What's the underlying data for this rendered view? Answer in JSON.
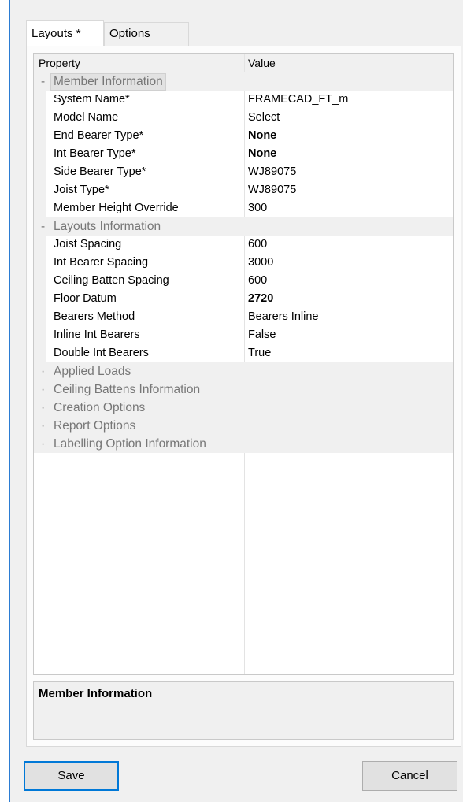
{
  "tabs": [
    {
      "label": "Layouts *",
      "active": true
    },
    {
      "label": "Options",
      "active": false
    }
  ],
  "grid": {
    "header": {
      "property": "Property",
      "value": "Value"
    },
    "rows": [
      {
        "kind": "cat",
        "toggle": "-",
        "label": "Member Information",
        "selected": true
      },
      {
        "kind": "prop",
        "label": "System Name*",
        "value": "FRAMECAD_FT_m",
        "bold": false
      },
      {
        "kind": "prop",
        "label": "Model Name",
        "value": "Select",
        "bold": false
      },
      {
        "kind": "prop",
        "label": "End Bearer Type*",
        "value": "None",
        "bold": true
      },
      {
        "kind": "prop",
        "label": "Int Bearer Type*",
        "value": "None",
        "bold": true
      },
      {
        "kind": "prop",
        "label": "Side Bearer Type*",
        "value": "WJ89075",
        "bold": false
      },
      {
        "kind": "prop",
        "label": "Joist Type*",
        "value": "WJ89075",
        "bold": false
      },
      {
        "kind": "prop",
        "label": "Member Height Override",
        "value": "300",
        "bold": false
      },
      {
        "kind": "cat",
        "toggle": "-",
        "label": "Layouts Information",
        "selected": false
      },
      {
        "kind": "prop",
        "label": "Joist Spacing",
        "value": "600",
        "bold": false
      },
      {
        "kind": "prop",
        "label": "Int Bearer Spacing",
        "value": "3000",
        "bold": false
      },
      {
        "kind": "prop",
        "label": "Ceiling Batten Spacing",
        "value": "600",
        "bold": false
      },
      {
        "kind": "prop",
        "label": "Floor Datum",
        "value": "2720",
        "bold": true
      },
      {
        "kind": "prop",
        "label": "Bearers Method",
        "value": "Bearers Inline",
        "bold": false
      },
      {
        "kind": "prop",
        "label": "Inline Int Bearers",
        "value": "False",
        "bold": false
      },
      {
        "kind": "prop",
        "label": "Double Int Bearers",
        "value": "True",
        "bold": false
      },
      {
        "kind": "cat",
        "toggle": "·",
        "label": "Applied Loads",
        "selected": false
      },
      {
        "kind": "cat",
        "toggle": "·",
        "label": "Ceiling Battens Information",
        "selected": false
      },
      {
        "kind": "cat",
        "toggle": "·",
        "label": "Creation Options",
        "selected": false
      },
      {
        "kind": "cat",
        "toggle": "·",
        "label": "Report Options",
        "selected": false
      },
      {
        "kind": "cat",
        "toggle": "·",
        "label": "Labelling Option Information",
        "selected": false
      }
    ]
  },
  "description": {
    "title": "Member Information"
  },
  "buttons": {
    "save": "Save",
    "cancel": "Cancel"
  },
  "colors": {
    "accent": "#0078d7",
    "category_bg": "#f0f0f0",
    "category_text": "#777777"
  }
}
